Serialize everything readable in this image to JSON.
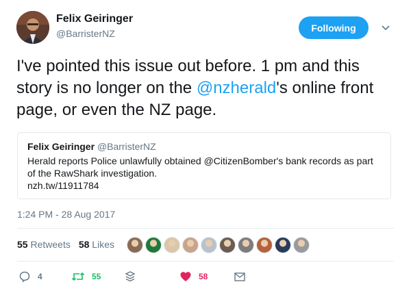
{
  "author": {
    "name": "Felix Geiringer",
    "handle": "@BarristerNZ"
  },
  "follow_button": {
    "label": "Following"
  },
  "tweet": {
    "text_before": "I've pointed this issue out before. 1 pm and this story is no longer on the ",
    "mention": "@nzherald",
    "text_after": "'s online front page, or even the NZ page."
  },
  "quoted_tweet": {
    "name": "Felix Geiringer",
    "handle": "@BarristerNZ",
    "text": "Herald reports Police unlawfully obtained @CitizenBomber's bank records as part of the RawShark investigation.",
    "link": "nzh.tw/11911784"
  },
  "timestamp": "1:24 PM - 28 Aug 2017",
  "stats": {
    "retweets_count": "55",
    "retweets_label": "Retweets",
    "likes_count": "58",
    "likes_label": "Likes"
  },
  "liker_avatars": [
    {
      "icon": "user-avatar",
      "color": "#8a6a55"
    },
    {
      "icon": "user-avatar",
      "color": "#1f7a3a"
    },
    {
      "icon": "user-avatar",
      "color": "#d9c7a8"
    },
    {
      "icon": "user-avatar",
      "color": "#c9a48a"
    },
    {
      "icon": "user-avatar",
      "color": "#b8c2cc"
    },
    {
      "icon": "user-avatar",
      "color": "#6a5c52"
    },
    {
      "icon": "user-avatar",
      "color": "#7d7d7d"
    },
    {
      "icon": "user-avatar",
      "color": "#b5623c"
    },
    {
      "icon": "user-avatar",
      "color": "#2a3a5c"
    },
    {
      "icon": "user-avatar",
      "color": "#9a9a9a"
    }
  ],
  "actions": {
    "reply_count": "4",
    "retweet_count": "55",
    "like_count": "58"
  },
  "colors": {
    "accent": "#1da1f2",
    "retweet": "#17bf63",
    "like": "#e0245e",
    "muted": "#657786"
  }
}
